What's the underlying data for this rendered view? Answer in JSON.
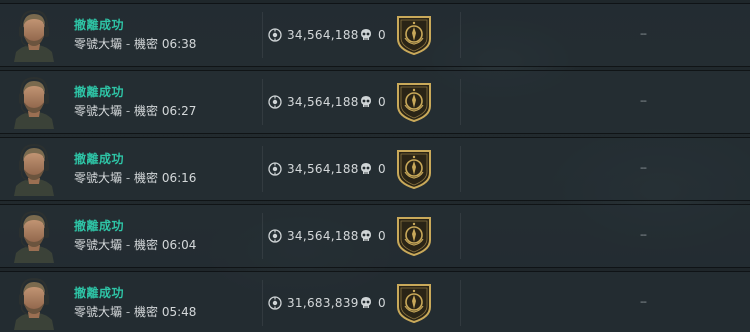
{
  "rows": [
    {
      "status": "撤離成功",
      "map": "零號大壩",
      "separator": "-",
      "mode": "機密",
      "time": "06:38",
      "value": "34,564,188",
      "kills": "0",
      "extra": "--"
    },
    {
      "status": "撤離成功",
      "map": "零號大壩",
      "separator": "-",
      "mode": "機密",
      "time": "06:27",
      "value": "34,564,188",
      "kills": "0",
      "extra": "--"
    },
    {
      "status": "撤離成功",
      "map": "零號大壩",
      "separator": "-",
      "mode": "機密",
      "time": "06:16",
      "value": "34,564,188",
      "kills": "0",
      "extra": "--"
    },
    {
      "status": "撤離成功",
      "map": "零號大壩",
      "separator": "-",
      "mode": "機密",
      "time": "06:04",
      "value": "34,564,188",
      "kills": "0",
      "extra": "--"
    },
    {
      "status": "撤離成功",
      "map": "零號大壩",
      "separator": "-",
      "mode": "機密",
      "time": "05:48",
      "value": "31,683,839",
      "kills": "0",
      "extra": "--"
    }
  ],
  "icons": {
    "value": "value-coin-icon",
    "kills": "skull-icon",
    "badge": "rank-shield-badge-icon",
    "avatar": "operator-avatar-icon"
  },
  "colors": {
    "status_success": "#2ec4a6",
    "badge_gold": "#c9a95a",
    "badge_dark": "#2a2416"
  }
}
